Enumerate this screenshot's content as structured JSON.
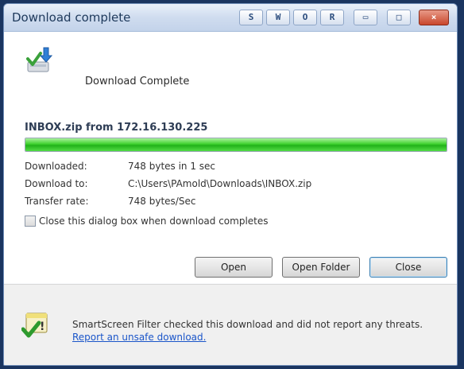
{
  "window": {
    "title": "Download complete",
    "buttons": [
      {
        "label": "S"
      },
      {
        "label": "W"
      },
      {
        "label": "O"
      },
      {
        "label": "R"
      },
      {
        "label": "▭"
      },
      {
        "label": "□"
      },
      {
        "label": "×"
      }
    ]
  },
  "header": {
    "icon": "download-complete-icon",
    "text": "Download Complete"
  },
  "file": {
    "line": "INBOX.zip from 172.16.130.225"
  },
  "progress": {
    "percent": 100,
    "color": "#3ed12d"
  },
  "details": [
    {
      "label": "Downloaded:",
      "value": "748 bytes in 1 sec"
    },
    {
      "label": "Download to:",
      "value": "C:\\Users\\PAmold\\Downloads\\INBOX.zip"
    },
    {
      "label": "Transfer rate:",
      "value": "748 bytes/Sec"
    }
  ],
  "checkbox": {
    "label": "Close this dialog box when download completes",
    "checked": false
  },
  "buttons": {
    "open": "Open",
    "open_folder": "Open Folder",
    "close": "Close"
  },
  "footer": {
    "icon": "smartscreen-shield-icon",
    "text": "SmartScreen Filter checked this download and did not report any threats.",
    "link": "Report an unsafe download."
  }
}
